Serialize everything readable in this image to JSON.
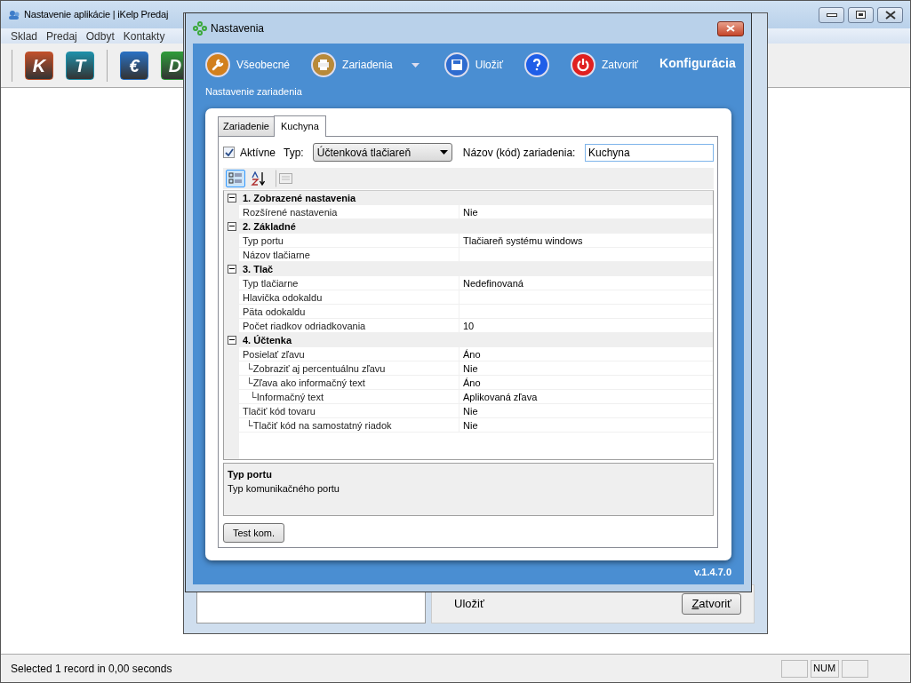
{
  "app_window": {
    "title": "Nastavenie aplikácie | iKelp Predaj",
    "menu": [
      "Sklad",
      "Predaj",
      "Odbyt",
      "Kontakty"
    ],
    "toolbar": [
      {
        "glyph": "K",
        "color": "#c0502a"
      },
      {
        "glyph": "T",
        "color": "#1f8fa8"
      },
      {
        "glyph": "€",
        "color": "#2a6fc0"
      },
      {
        "glyph": "D",
        "color": "#2f9a3a"
      }
    ]
  },
  "background_window": {
    "action_label": "Uložiť",
    "close_button": "Zatvoriť"
  },
  "dialog": {
    "title": "Nastavenia",
    "toolbar": [
      {
        "kind": "general",
        "label": "Všeobecné"
      },
      {
        "kind": "devices",
        "label": "Zariadenia",
        "dropdown": true
      },
      {
        "kind": "separator"
      },
      {
        "kind": "save",
        "label": "Uložiť"
      },
      {
        "kind": "help"
      },
      {
        "kind": "close",
        "label": "Zatvoriť"
      }
    ],
    "heading": "Konfigurácia",
    "subtitle": "Nastavenie zariadenia",
    "tabs": [
      {
        "label": "Zariadenie",
        "selected": false
      },
      {
        "label": "Kuchyna",
        "selected": true
      }
    ],
    "device": {
      "active_label": "Aktívne",
      "active_checked": true,
      "type_label": "Typ:",
      "type_value": "Účtenková tlačiareň",
      "name_label": "Názov (kód) zariadenia:",
      "name_value": "Kuchyna"
    },
    "grid_toolbar": [
      {
        "kind": "categorized",
        "selected": true
      },
      {
        "kind": "alphabetical",
        "selected": false
      },
      {
        "kind": "pages",
        "disabled": true
      }
    ],
    "properties": [
      {
        "label": "1. Zobrazené nastavenia",
        "expanded": true,
        "rows": [
          {
            "name": "Rozšírené nastavenia",
            "value": "Nie"
          }
        ]
      },
      {
        "label": "2. Základné",
        "expanded": true,
        "rows": [
          {
            "name": "Typ portu",
            "value": "Tlačiareň systému windows"
          },
          {
            "name": "Názov tlačiarne"
          }
        ]
      },
      {
        "label": "3. Tlač",
        "expanded": true,
        "rows": [
          {
            "name": "Typ tlačiarne",
            "value": "Nedefinovaná"
          },
          {
            "name": "Hlavička odokaldu"
          },
          {
            "name": "Päta odokaldu"
          },
          {
            "name": "Počet riadkov odriadkovania",
            "value": "10"
          }
        ]
      },
      {
        "label": "4. Účtenka",
        "expanded": true,
        "rows": [
          {
            "name": "Posielať zľavu",
            "value": "Áno",
            "children": [
              {
                "name": "└Zobraziť aj percentuálnu zľavu",
                "value": "Nie"
              },
              {
                "name": "└Zľava ako informačný text",
                "value": "Áno",
                "children": [
                  {
                    "name": "└Informačný text",
                    "value": "Aplikovaná zľava"
                  }
                ]
              }
            ]
          },
          {
            "name": "Tlačiť kód tovaru",
            "value": "Nie",
            "children": [
              {
                "name": "└Tlačiť kód na samostatný riadok",
                "value": "Nie"
              }
            ]
          }
        ]
      }
    ],
    "description": {
      "title": "Typ portu",
      "text": "Typ komunikačného portu"
    },
    "test_button": "Test kom.",
    "version": "v.1.4.7.0"
  },
  "status_bar": {
    "text": "Selected 1 record in 0,00 seconds",
    "num": "NUM"
  }
}
